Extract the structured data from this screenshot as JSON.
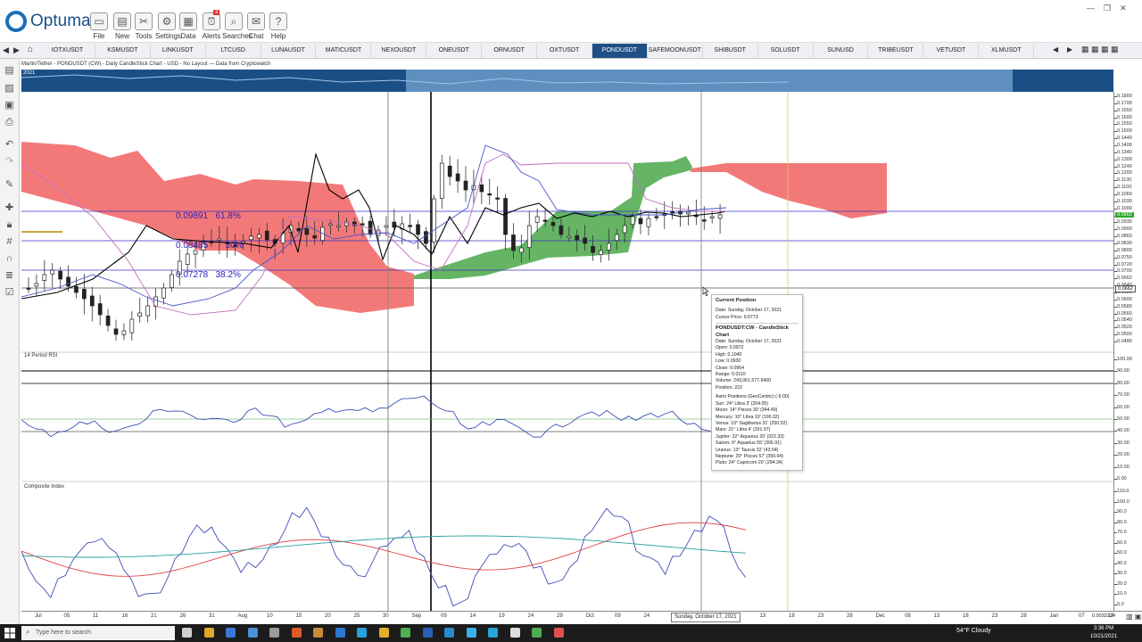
{
  "app": {
    "name": "Optuma",
    "toolbar": [
      {
        "label": "File",
        "icon": "folder-icon"
      },
      {
        "label": "New",
        "icon": "new-page-icon"
      },
      {
        "label": "Tools",
        "icon": "tools-icon"
      },
      {
        "label": "Settings",
        "icon": "gear-icon"
      },
      {
        "label": "Data",
        "icon": "data-icon"
      },
      {
        "label": "Alerts",
        "icon": "alarm-icon",
        "badge": "3"
      },
      {
        "label": "Searches",
        "icon": "search-icon"
      },
      {
        "label": "Chat",
        "icon": "chat-icon"
      },
      {
        "label": "Help",
        "icon": "help-icon"
      }
    ],
    "tabs": [
      "IOTXUSDT",
      "KSMUSDT",
      "LINKUSDT",
      "LTCUSD",
      "LUNAUSDT",
      "MATICUSDT",
      "NEXOUSDT",
      "ONEUSDT",
      "ORNUSDT",
      "OXTUSDT",
      "PONDUSDT",
      "SAFEMOONUSDT",
      "SHIBUSDT",
      "SOLUSDT",
      "SUNUSD",
      "TRIBEUSDT",
      "VETUSDT",
      "XLMUSDT"
    ],
    "active_tab": "PONDUSDT",
    "chart_info": "Marlin/Tether - PONDUSDT (CW) - Daily CandleStick Chart - USD - No Layout — Data from Cryptowatch",
    "overview_year": "2021"
  },
  "fib_labels": [
    {
      "value": "0.09891",
      "pct": "61.8%"
    },
    {
      "value": "0.08485",
      "pct": "50%"
    },
    {
      "value": "0.07278",
      "pct": "38.2%"
    }
  ],
  "price_axis": [
    "0.1800",
    "0.1700",
    "0.1650",
    "0.1600",
    "0.1550",
    "0.1500",
    "0.1440",
    "0.1400",
    "0.1340",
    "0.1300",
    "0.1240",
    "0.1200",
    "0.1130",
    "0.1100",
    "0.1060",
    "0.1030",
    "0.1000",
    "0.0962",
    "0.0930",
    "0.0900",
    "0.0860",
    "0.0830",
    "0.0800",
    "0.0750",
    "0.0720",
    "0.0700",
    "0.0662",
    "0.0640",
    "0.0620",
    "0.0600",
    "0.0580",
    "0.0560",
    "0.0540",
    "0.0520",
    "0.0500",
    "0.0480"
  ],
  "current_price_tag": "0.0962",
  "cursor_price_tag": "0.0662",
  "rsi_panel": {
    "title": "14 Period RSI",
    "axis": [
      "100.00",
      "90.00",
      "80.00",
      "70.00",
      "60.00",
      "50.00",
      "40.00",
      "30.00",
      "20.00",
      "10.00",
      "0.00"
    ]
  },
  "composite_panel": {
    "title": "Composite Index",
    "axis": [
      "110.0",
      "100.0",
      "90.0",
      "80.0",
      "70.0",
      "60.0",
      "50.0",
      "40.0",
      "30.0",
      "20.0",
      "10.0",
      "0.0"
    ]
  },
  "date_axis": [
    "Jul",
    "05",
    "11",
    "16",
    "21",
    "26",
    "31",
    "Aug",
    "10",
    "15",
    "20",
    "25",
    "30",
    "Sep",
    "09",
    "14",
    "19",
    "24",
    "29",
    "Oct",
    "09",
    "24",
    "29",
    "Nov",
    "08",
    "13",
    "18",
    "23",
    "28",
    "Dec",
    "08",
    "13",
    "18",
    "23",
    "28",
    "Jan",
    "07",
    "12"
  ],
  "cursor_date": "Sunday, October 17, 2021",
  "axis_corner": "0.0032224",
  "tooltip": {
    "title": "Current Position",
    "date": "Date: Sunday, October 17, 2021",
    "cursor_price": "Cursor Price: 0.0773",
    "section": "PONDUSDT:CW - CandleStick Chart",
    "rows": [
      "Date: Sunday, October 17, 2021",
      "Open: 0.0972",
      "High: 0.1040",
      "Low: 0.0930",
      "Close: 0.0964",
      "Range: 0.0110",
      "Volume: 243,061,577.9400",
      "Position: 222"
    ],
    "astro_title": "Astro Positions (GeoCentric) (-5:00)",
    "astro": [
      "Sun: 24° Libra 3' (204.05)",
      "Moon: 14° Pisces 30' (344.49)",
      "Mercury: 10° Libra 19' (190.32)",
      "Venus: 10° Sagittarius 31' (250.52)",
      "Mars: 21° Libra 4' (201.07)",
      "Jupiter: 22° Aquarius 20' (322.33)",
      "Saturn: 6° Aquarius 55' (306.91)",
      "Uranus: 13° Taurus 32' (43.54)",
      "Neptune: 20° Pisces 57' (350.94)",
      "Pluto: 24° Capricorn 20' (294.34)"
    ]
  },
  "taskbar": {
    "search_placeholder": "Type here to search",
    "weather": "54°F  Cloudy",
    "time": "3:36 PM",
    "date": "10/21/2021"
  },
  "colors": {
    "kumo_bear": "#f26a6a",
    "kumo_bull": "#4aa84a",
    "fib_line": "#3a2fc0",
    "navy": "#1a4f86"
  }
}
